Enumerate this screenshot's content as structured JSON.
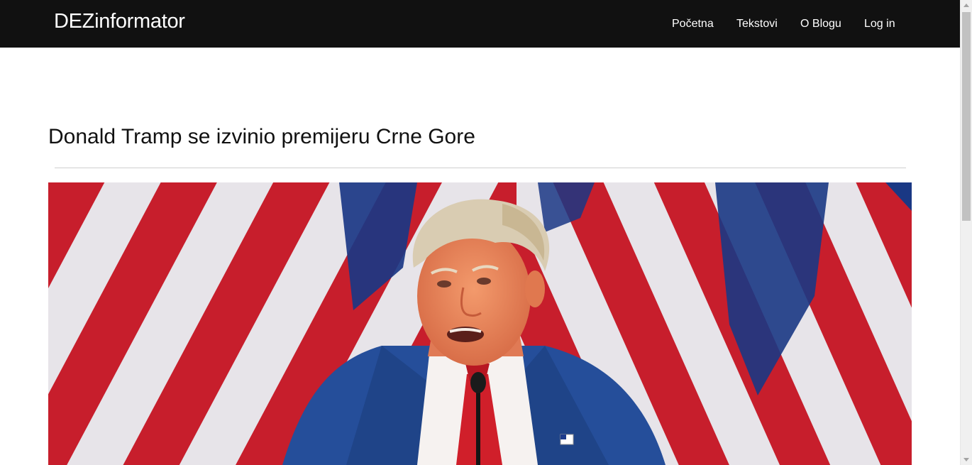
{
  "navbar": {
    "brand": "DEZinformator",
    "links": [
      {
        "label": "Početna"
      },
      {
        "label": "Tekstovi"
      },
      {
        "label": "O Blogu"
      },
      {
        "label": "Log in"
      }
    ]
  },
  "article": {
    "title": "Donald Tramp se izvinio premijeru Crne Gore"
  },
  "colors": {
    "navbar_bg": "#111111",
    "flag_red": "#d2202f",
    "flag_white": "#f4f1f6",
    "flag_blue": "#1c3b8c",
    "suit_blue": "#254e9a",
    "tie_red": "#d01f2a"
  }
}
